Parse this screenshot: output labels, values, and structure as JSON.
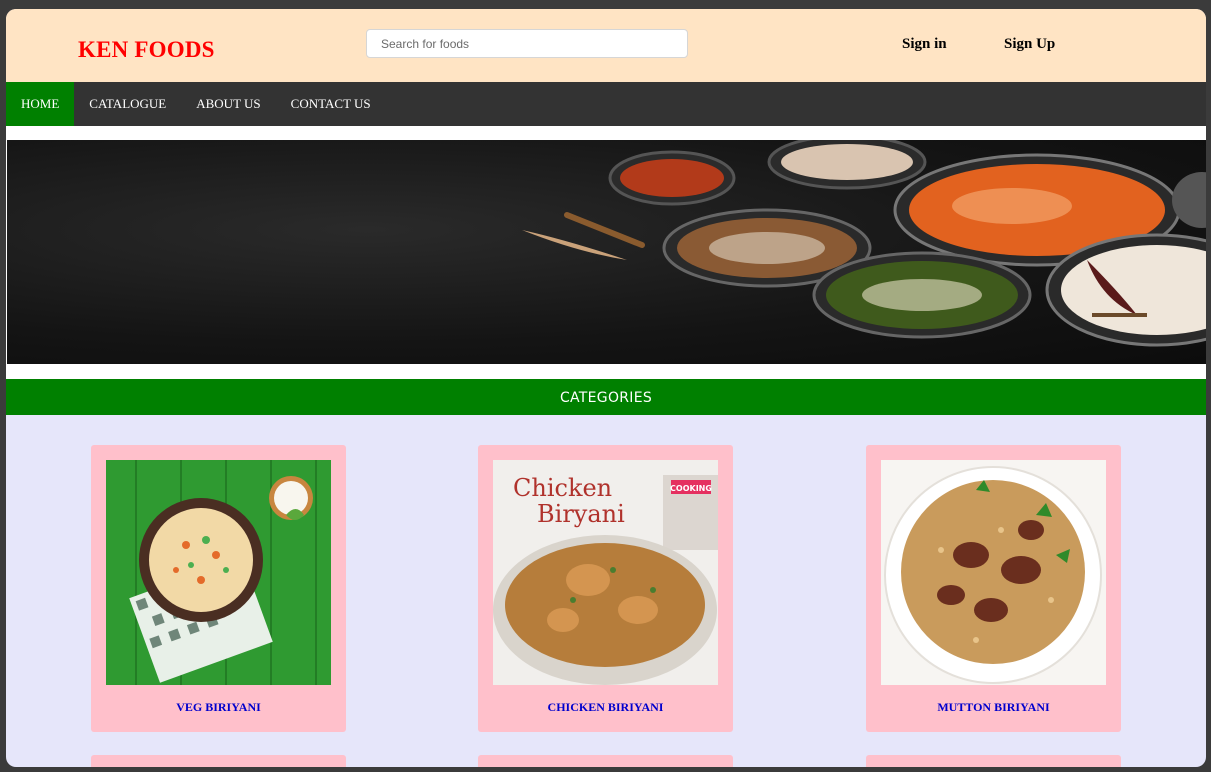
{
  "header": {
    "brand": "KEN FOODS",
    "search_placeholder": "Search for foods",
    "signin_label": "Sign in",
    "signup_label": "Sign Up"
  },
  "nav": {
    "items": [
      {
        "label": "HOME",
        "active": true
      },
      {
        "label": "CATALOGUE"
      },
      {
        "label": "ABOUT US"
      },
      {
        "label": "CONTACT US"
      }
    ]
  },
  "categories": {
    "title": "CATEGORIES",
    "items": [
      {
        "label": "VEG BIRIYANI",
        "image": "veg-biriyani-image"
      },
      {
        "label": "CHICKEN BIRIYANI",
        "image": "chicken-biriyani-image",
        "image_text": [
          "Chicken",
          "Biryani",
          "COOKING"
        ]
      },
      {
        "label": "MUTTON BIRIYANI",
        "image": "mutton-biriyani-image"
      }
    ]
  },
  "colors": {
    "brand": "#ff0000",
    "header_bg": "#ffe4c4",
    "nav_bg": "#333333",
    "active_green": "#008000",
    "card_bg": "#ffc0cb",
    "card_title": "#0000cd",
    "page_bg": "#e6e6fa"
  }
}
